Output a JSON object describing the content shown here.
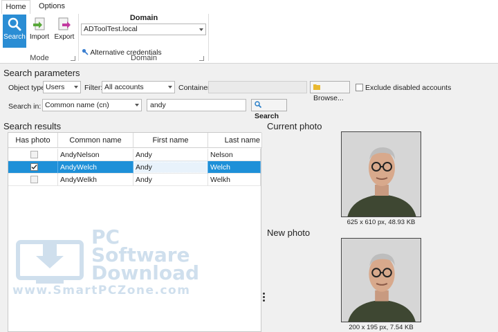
{
  "tabs": [
    {
      "label": "Home",
      "active": true
    },
    {
      "label": "Options",
      "active": false
    }
  ],
  "ribbon": {
    "mode_group": {
      "label": "Mode",
      "buttons": [
        {
          "label": "Search",
          "icon": "search-icon",
          "active": true
        },
        {
          "label": "Import",
          "icon": "import-icon",
          "active": false
        },
        {
          "label": "Export",
          "icon": "export-icon",
          "active": false
        }
      ]
    },
    "domain_group": {
      "title": "Domain",
      "label": "Domain",
      "domain_value": "ADToolTest.local",
      "alt_credentials": "Alternative credentials"
    }
  },
  "search_params": {
    "title": "Search parameters",
    "object_type_label": "Object type:",
    "object_type_value": "Users",
    "filter_label": "Filter:",
    "filter_value": "All accounts",
    "container_label": "Container:",
    "container_value": "",
    "browse_label": "Browse...",
    "exclude_disabled_label": "Exclude disabled accounts",
    "exclude_disabled_checked": false,
    "search_in_label": "Search in:",
    "search_in_value": "Common name (cn)",
    "query_value": "andy",
    "search_button": "Search"
  },
  "results": {
    "title": "Search results",
    "columns": [
      "Has photo",
      "Common name",
      "First name",
      "Last name"
    ],
    "rows": [
      {
        "has_photo": false,
        "common_name": "AndyNelson",
        "first_name": "Andy",
        "last_name": "Nelson",
        "selected": false
      },
      {
        "has_photo": true,
        "common_name": "AndyWelch",
        "first_name": "Andy",
        "last_name": "Welch",
        "selected": true
      },
      {
        "has_photo": false,
        "common_name": "AndyWelkh",
        "first_name": "Andy",
        "last_name": "Welkh",
        "selected": false
      }
    ]
  },
  "current_photo": {
    "title": "Current photo",
    "caption": "625 x 610 px, 48.93 KB"
  },
  "new_photo": {
    "title": "New photo",
    "caption": "200 x 195 px, 7.54 KB"
  },
  "watermark": {
    "line1": "PC",
    "line2": "Software",
    "line3": "Download",
    "line4": "www.SmartPCZone.com"
  },
  "colors": {
    "accent": "#2a8dd4",
    "selection": "#1e90d8"
  }
}
